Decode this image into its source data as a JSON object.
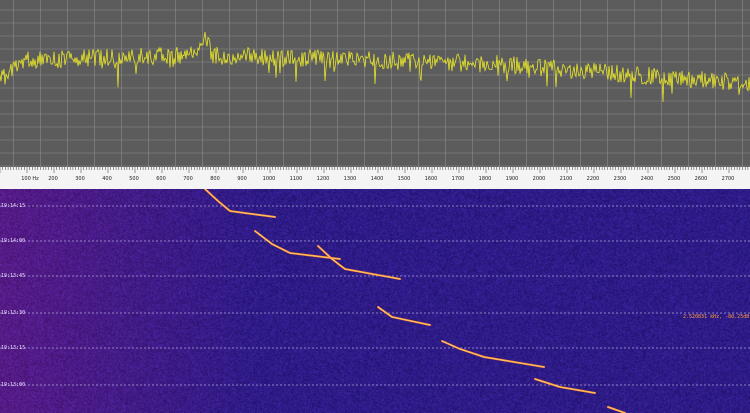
{
  "colors": {
    "spectrum_bg": "#5c5c5c",
    "spectrum_trace": "#e8e62a",
    "grid": "#8a8a8a",
    "waterfall_trace": "#ff8a2a",
    "cursor_text": "#ff9a3c"
  },
  "ruler": {
    "unit_label": "100 Hz",
    "ticks": [
      "200",
      "300",
      "400",
      "500",
      "600",
      "700",
      "800",
      "900",
      "1000",
      "1100",
      "1200",
      "1300",
      "1400",
      "1500",
      "1600",
      "1700",
      "1800",
      "1900",
      "2000",
      "2100",
      "2200",
      "2300",
      "2400",
      "2500",
      "2600",
      "2700"
    ]
  },
  "waterfall": {
    "time_labels": [
      "19:14:15",
      "19:14:00",
      "19:13:45",
      "19:13:30",
      "19:13:15",
      "19:13:00"
    ],
    "cursor_readout": "2.520831 kHz, -80.25dB"
  }
}
